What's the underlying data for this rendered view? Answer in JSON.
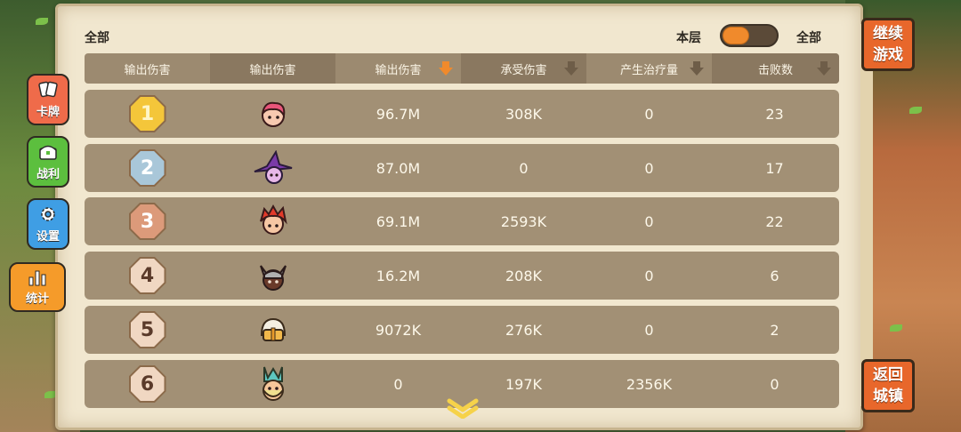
{
  "filter": {
    "left_label": "全部",
    "toggle_left": "本层",
    "toggle_right": "全部"
  },
  "table": {
    "headers": [
      {
        "label": "输出伤害",
        "sortable": false
      },
      {
        "label": "输出伤害",
        "sortable": false
      },
      {
        "label": "输出伤害",
        "sortable": true,
        "active": true
      },
      {
        "label": "承受伤害",
        "sortable": true,
        "active": false
      },
      {
        "label": "产生治疗量",
        "sortable": true,
        "active": false
      },
      {
        "label": "击败数",
        "sortable": true,
        "active": false
      }
    ],
    "rows": [
      {
        "rank": "1",
        "hero": "pink-hair-hero-icon",
        "damage": "96.7M",
        "taken": "308K",
        "heal": "0",
        "kills": "23"
      },
      {
        "rank": "2",
        "hero": "witch-hat-hero-icon",
        "damage": "87.0M",
        "taken": "0",
        "heal": "0",
        "kills": "17"
      },
      {
        "rank": "3",
        "hero": "red-hair-hero-icon",
        "damage": "69.1M",
        "taken": "2593K",
        "heal": "0",
        "kills": "22"
      },
      {
        "rank": "4",
        "hero": "horned-helmet-hero-icon",
        "damage": "16.2M",
        "taken": "208K",
        "heal": "0",
        "kills": "6"
      },
      {
        "rank": "5",
        "hero": "white-helmet-hero-icon",
        "damage": "9072K",
        "taken": "276K",
        "heal": "0",
        "kills": "2"
      },
      {
        "rank": "6",
        "hero": "crown-hero-icon",
        "damage": "0",
        "taken": "197K",
        "heal": "2356K",
        "kills": "0"
      }
    ]
  },
  "side_tabs": {
    "cards": "卡牌",
    "loot": "战利",
    "settings": "设置",
    "stats": "统计"
  },
  "buttons": {
    "continue_line1": "继续",
    "continue_line2": "游戏",
    "return_line1": "返回",
    "return_line2": "城镇"
  },
  "colors": {
    "accent": "#e8672b",
    "sort_active": "#f08a2c",
    "sort_inactive": "#6e5d48"
  }
}
